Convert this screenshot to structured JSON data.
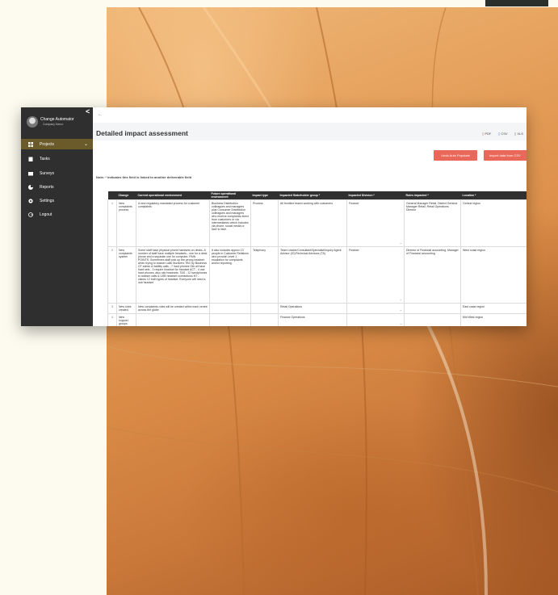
{
  "app": {
    "brand": "Change Automator",
    "company": "Company Demo",
    "collapse_icon": "chevron-left-icon",
    "nav": [
      {
        "label": "Projects",
        "icon": "grid-icon",
        "active": true
      },
      {
        "label": "Tasks",
        "icon": "clipboard-icon"
      },
      {
        "label": "Surveys",
        "icon": "survey-icon"
      },
      {
        "label": "Reports",
        "icon": "pie-chart-icon"
      },
      {
        "label": "Settings",
        "icon": "gear-icon"
      },
      {
        "label": "Logout",
        "icon": "logout-icon"
      }
    ],
    "back": "←",
    "page_title": "Detailed impact assessment",
    "export": {
      "pdf": "PDF",
      "csv": "CSV",
      "xls": "XLS"
    },
    "buttons": {
      "undo": "Undo Auto Populate",
      "import": "Import data from CSV"
    },
    "note": "Note: * indicates this field is linked to another deliverable field",
    "table": {
      "headers": [
        "",
        "Change",
        "Current operational environment",
        "Future operational environment",
        "Impact type",
        "Impacted Stakeholder group *",
        "Impacted Division *",
        "Roles impacted *",
        "Location *"
      ],
      "rows": [
        [
          "1",
          "New complaints process",
          "A new regulatory mandated process for customer complaints",
          "Business Distribution colleagues and managers plus Consumer Distribution colleagues and managers who receive complaints direct from customers or via intermediaries which includes via phone, social media or face to face.",
          "Process",
          "All frontline teams working with customers",
          "Finance",
          "General Manager Retail, District General Manager Retail, Retail Operations Director",
          "Central region"
        ],
        [
          "2",
          "New complaints system",
          "Some staff have physical phone handsets on desks. A number of staff have multiple headsets - one for a desk phone and a separate one for computer. PAIN POINTS: Sometimes staff pick up the wrong headset when trying to answer calls Numbers TBC by Business CF admin & liability calls - 7 hard phones Oth all have hard sets - 3 require headset for handset ACT - 4 use hard phones, also usb headsets. TAS - 12 handphones to answer calls & USB headset connections NT - claims 12 both types of headset. Everyone will need a usb headset",
          "It also includes approx 13 people in Customer Relations who provide Level 1 escalation for complaints and/or reporting.",
          "Telephony",
          "Team Leader/Consultant/Specialist/Inquiry Agent Advisor (IO)/Technical Advisors (TA)",
          "Finance",
          "Director of Financial accounting, Manager of Financial accounting",
          "West coast region"
        ],
        [
          "3",
          "New roles created",
          "New complaints roles will be created within each centre across the globe",
          "",
          "",
          "Retail Operations",
          "",
          "",
          "East coast region"
        ],
        [
          "4",
          "New support groups",
          "",
          "",
          "",
          "Finance Operations",
          "",
          "",
          "Mid West region"
        ]
      ]
    }
  }
}
